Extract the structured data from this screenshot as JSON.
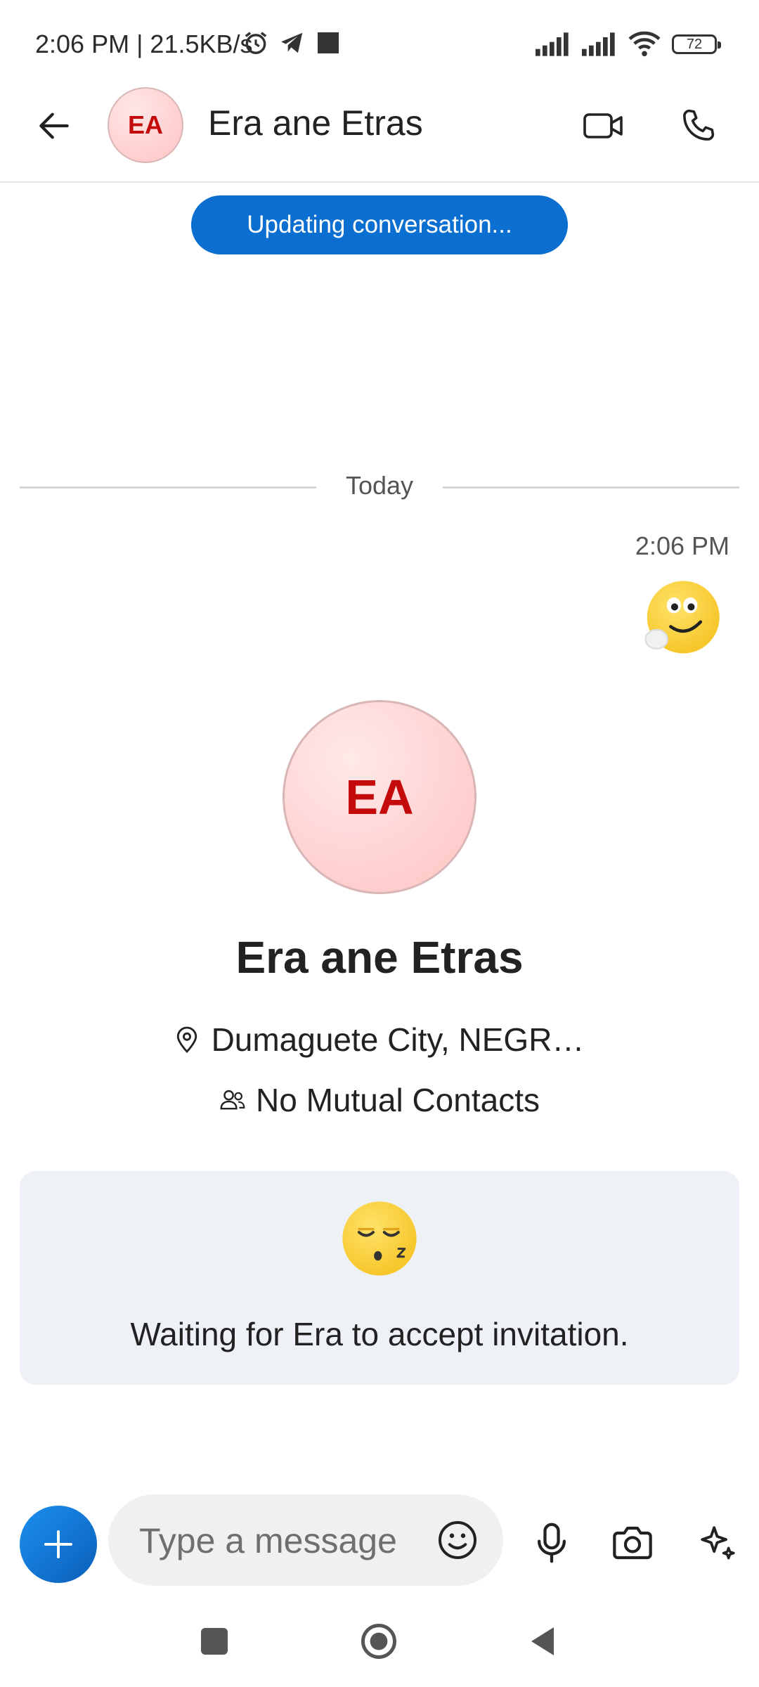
{
  "status_bar": {
    "time_speed": "2:06 PM | 21.5KB/s",
    "battery": "72"
  },
  "header": {
    "avatar_initials": "EA",
    "contact_name": "Era ane Etras"
  },
  "banner": {
    "updating": "Updating conversation..."
  },
  "conversation": {
    "date_label": "Today",
    "message_time": "2:06 PM",
    "message_emoji": "thinking-emoji"
  },
  "profile": {
    "avatar_initials": "EA",
    "name": "Era ane Etras",
    "location": "Dumaguete City, NEGR…",
    "mutual": "No Mutual Contacts"
  },
  "invite": {
    "emoji": "sleeping-emoji",
    "text": "Waiting for Era to accept invitation."
  },
  "composer": {
    "placeholder": "Type a message"
  },
  "colors": {
    "accent": "#0a6fd0",
    "avatar_text": "#c40a0a",
    "card_bg": "#eef1f6"
  }
}
